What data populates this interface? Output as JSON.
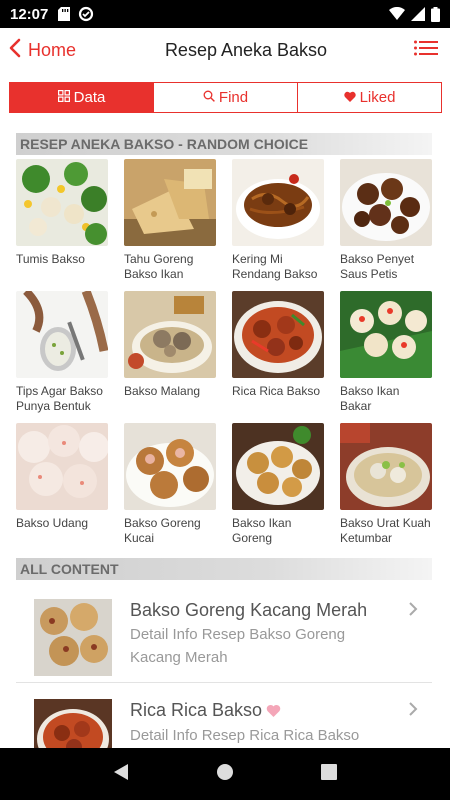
{
  "status_bar": {
    "time": "12:07",
    "icons_left": [
      "sd-card-icon",
      "data-saver-icon"
    ],
    "icons_right": [
      "wifi-icon",
      "signal-icon",
      "battery-icon"
    ]
  },
  "app_bar": {
    "back_label": "Home",
    "title": "Resep Aneka Bakso"
  },
  "tabs": [
    {
      "label": "Data",
      "icon": "grid-icon",
      "active": true
    },
    {
      "label": "Find",
      "icon": "search-icon",
      "active": false
    },
    {
      "label": "Liked",
      "icon": "heart-icon",
      "active": false
    }
  ],
  "random_section": {
    "header": "RESEP ANEKA BAKSO - RANDOM CHOICE",
    "items": [
      {
        "caption": "Tumis Bakso"
      },
      {
        "caption": "Tahu Goreng Bakso Ikan"
      },
      {
        "caption": "Kering Mi Rendang Bakso"
      },
      {
        "caption": "Bakso Penyet Saus Petis"
      },
      {
        "caption": "Tips Agar Bakso Punya Bentuk"
      },
      {
        "caption": "Bakso Malang"
      },
      {
        "caption": "Rica Rica Bakso"
      },
      {
        "caption": "Bakso Ikan Bakar"
      },
      {
        "caption": "Bakso Udang"
      },
      {
        "caption": "Bakso Goreng Kucai"
      },
      {
        "caption": "Bakso Ikan Goreng"
      },
      {
        "caption": "Bakso Urat Kuah Ketumbar"
      }
    ]
  },
  "all_content": {
    "header": "ALL CONTENT",
    "items": [
      {
        "title": "Bakso Goreng Kacang Merah",
        "subtitle": "Detail Info Resep Bakso Goreng Kacang Merah",
        "liked": false
      },
      {
        "title": "Rica Rica Bakso",
        "subtitle": "Detail Info Resep Rica Rica Bakso",
        "liked": true
      }
    ]
  },
  "colors": {
    "accent": "#e8312d",
    "heart_liked": "#f4a6b8"
  }
}
